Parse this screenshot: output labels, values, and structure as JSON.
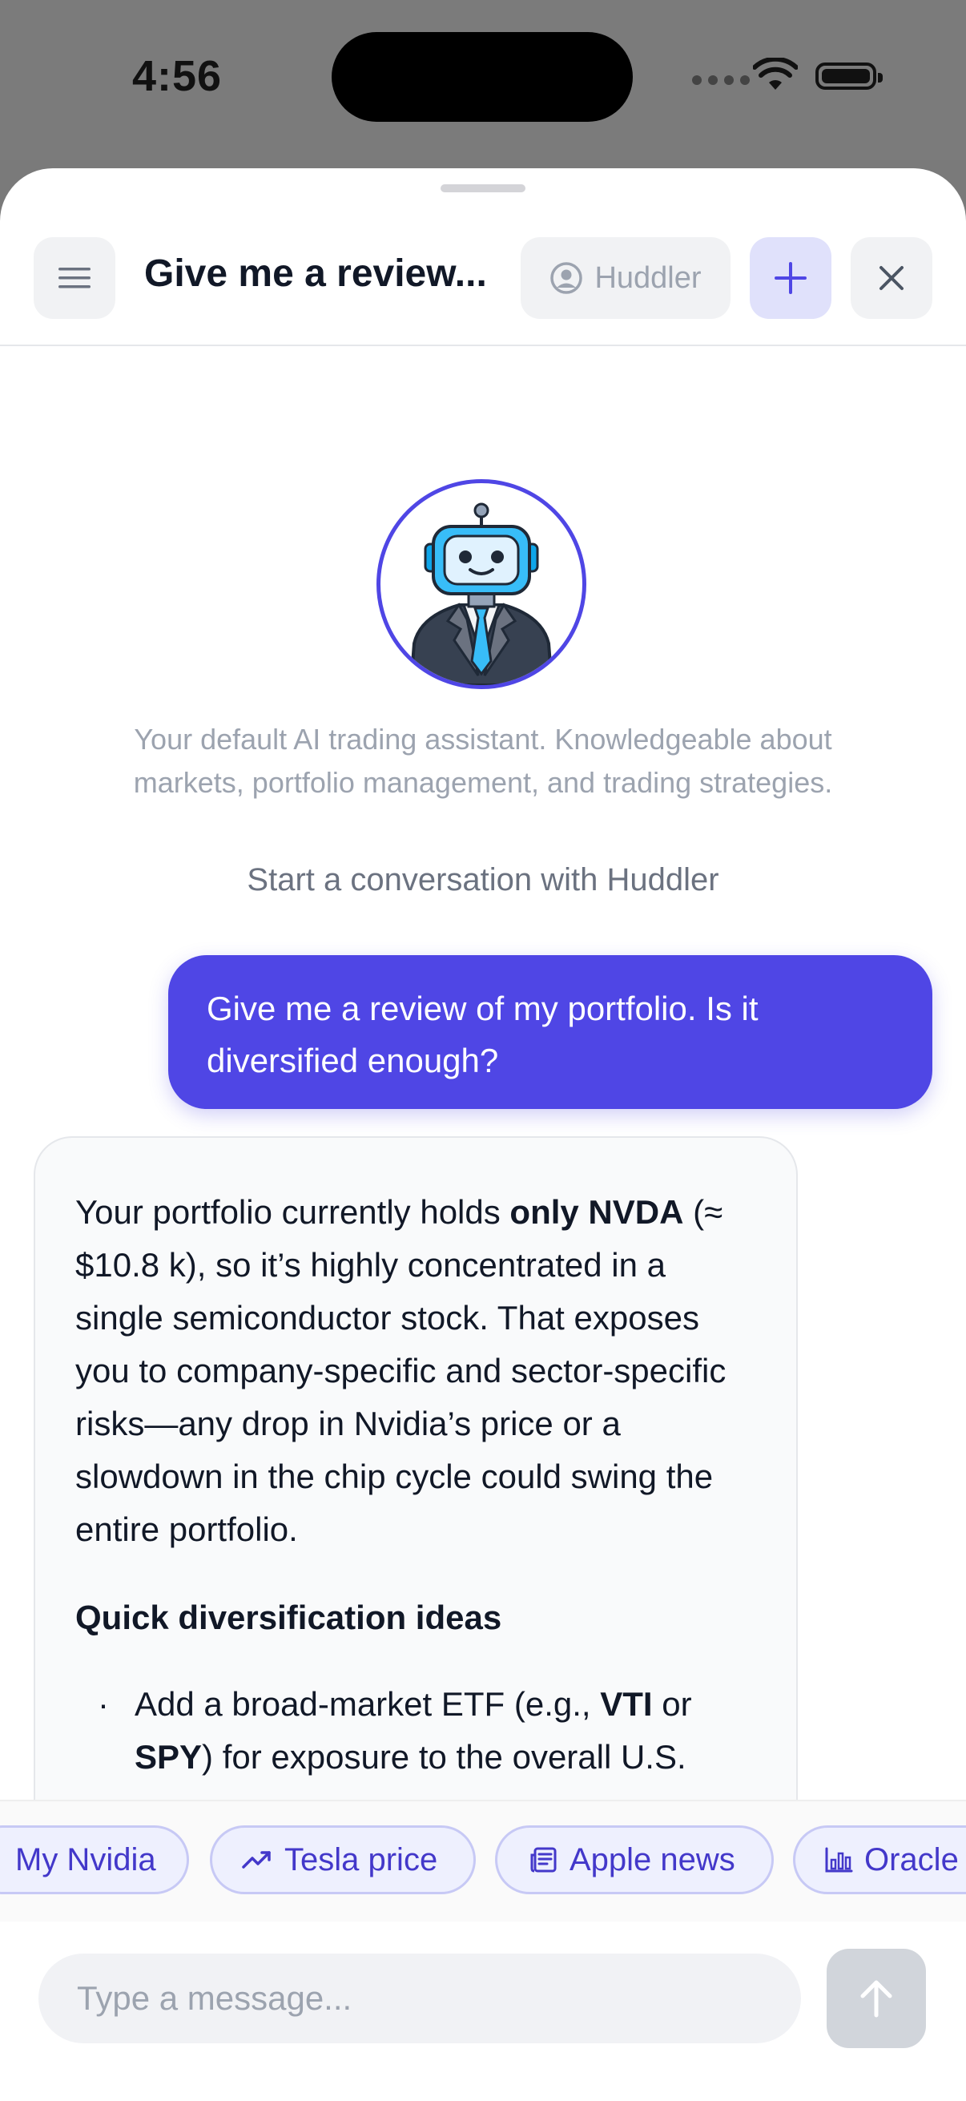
{
  "status_bar": {
    "time": "4:56"
  },
  "header": {
    "title": "Give me a review...",
    "agent_label": "Huddler"
  },
  "welcome": {
    "description": "Your default AI trading assistant. Knowledgeable about markets, portfolio management, and trading strategies.",
    "start_text": "Start a conversation with Huddler"
  },
  "messages": {
    "user": "Give me a review of my portfolio. Is it diversified enough?",
    "assistant": {
      "p1_a": "Your portfolio currently holds ",
      "p1_bold": "only NVDA",
      "p1_b": " (≈ $10.8 k), so it’s highly concentrated in a single semiconductor stock. That exposes you to company-specific and sector-specific risks—any drop in Nvidia’s price or a slowdown in the chip cycle could swing the entire portfolio.",
      "heading": "Quick diversification ideas",
      "li1_a": "Add a broad-market ETF (e.g., ",
      "li1_b1": "VTI",
      "li1_b": " or ",
      "li1_b2": "SPY",
      "li1_c": ") for exposure to the overall U.S."
    }
  },
  "suggestions": [
    {
      "label": "My Nvidia",
      "icon": "none"
    },
    {
      "label": "Tesla price",
      "icon": "trend-up-icon"
    },
    {
      "label": "Apple news",
      "icon": "newspaper-icon"
    },
    {
      "label": "Oracle",
      "icon": "bar-chart-icon"
    }
  ],
  "composer": {
    "placeholder": "Type a message..."
  },
  "colors": {
    "accent": "#4f46e5",
    "chip_bg": "#eef0fe",
    "chip_border": "#c7c9f5"
  }
}
